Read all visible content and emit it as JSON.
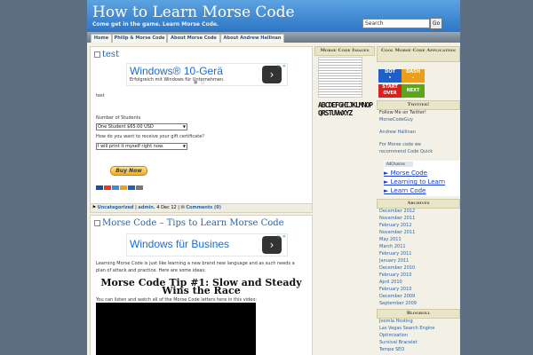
{
  "header": {
    "title": "How to Learn Morse Code",
    "tagline": "Come get in the game. Learn Morse Code.",
    "search_placeholder": "Search",
    "search_button": "Go"
  },
  "nav": {
    "tabs": [
      "Home",
      "Philip & Morse Code",
      "About Morse Code",
      "About Andrew Hallinan"
    ]
  },
  "post1": {
    "title": "test",
    "ad": {
      "title": "Windows® 10-Gerä",
      "sub": "Erfolgreich mit Windows für Unternehmen.",
      "arrow": "›",
      "close": "▷ ✕"
    },
    "body_text": "test",
    "students_label": "Number of Students",
    "students_value": "One Student $65.00 USD",
    "gift_label": "How do you want to receive your gift certificate?",
    "gift_value": "I will print it myself right now.",
    "buy_button": "Buy Now",
    "meta": {
      "category": "Uncategorized",
      "author": "admin.",
      "date": "4 Dec 12",
      "comments": "Comments (0)"
    }
  },
  "post2": {
    "title": "Morse Code – Tips to Learn Morse Code",
    "ad": {
      "title": "Windows für Busines",
      "arrow": "›",
      "close": "▷ ✕"
    },
    "intro": "Learning Morse Code is just like learning a new brand new language and as such needs a",
    "intro2": "plan of attack and practice. Here are some ideas:",
    "tip_line1": "Morse Code Tip #1: Slow and Steady",
    "tip_line2": "Wins the Race",
    "video_caption": "You can listen and watch all of the Morse Code letters here in this video:"
  },
  "sidebar1": {
    "title": "Morse Code Images",
    "letters": "ABCDEFGHIJKLMNOPQRSTUVWXYZ"
  },
  "sidebar2": {
    "app_title": "Cool Morse Code Application",
    "tiles": [
      "DOT",
      "DASH",
      "START OVER",
      "NEXT"
    ],
    "tiles_sub": [
      "•",
      "–",
      "",
      ""
    ],
    "tile_colors": [
      "#1e5fc8",
      "#e8a01e",
      "#d8201c",
      "#5aa818"
    ],
    "twitter_title": "Twitter!",
    "follow": "Follow Me on Twitter!",
    "handle": "MorseCodeGuy",
    "author": "Andrew Hallinan",
    "recommend1": "For Morse code we",
    "recommend2": "recommend Code Quick",
    "archives_title": "Archives",
    "archives": [
      "December 2012",
      "November 2011",
      "February 2012",
      "November 2011",
      "May 2011",
      "March 2011",
      "February 2011",
      "January 2011",
      "December 2010",
      "February 2010",
      "April 2010",
      "February 2010",
      "December 2009",
      "September 2009"
    ],
    "blogroll_title": "Blogroll",
    "blogroll": [
      "Joomla Hosting",
      "Las Vegas Search Engine",
      "Optimization",
      "Survival Bracelet",
      "Tempe SEO"
    ]
  },
  "popup": {
    "adchoices": "AdChoices",
    "links": [
      "► Morse Code",
      "► Learning to Learn",
      "► Learn Code"
    ]
  }
}
